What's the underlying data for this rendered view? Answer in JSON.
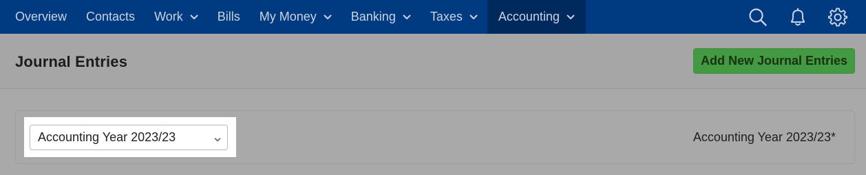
{
  "nav": {
    "items": [
      {
        "label": "Overview",
        "has_dropdown": false
      },
      {
        "label": "Contacts",
        "has_dropdown": false
      },
      {
        "label": "Work",
        "has_dropdown": true
      },
      {
        "label": "Bills",
        "has_dropdown": false
      },
      {
        "label": "My Money",
        "has_dropdown": true
      },
      {
        "label": "Banking",
        "has_dropdown": true
      },
      {
        "label": "Taxes",
        "has_dropdown": true
      },
      {
        "label": "Accounting",
        "has_dropdown": true,
        "active": true
      }
    ],
    "tools": [
      "search-icon",
      "bell-icon",
      "gear-icon"
    ]
  },
  "header": {
    "title": "Journal Entries",
    "add_button_label": "Add New Journal Entries"
  },
  "filter": {
    "selected_year": "Accounting Year 2023/23",
    "year_label": "Accounting Year 2023/23*"
  },
  "colors": {
    "nav_bg": "#003a80",
    "nav_active_bg": "#00295e",
    "add_button_bg": "#449a43",
    "overlay_bg": "#a9a9a9"
  }
}
